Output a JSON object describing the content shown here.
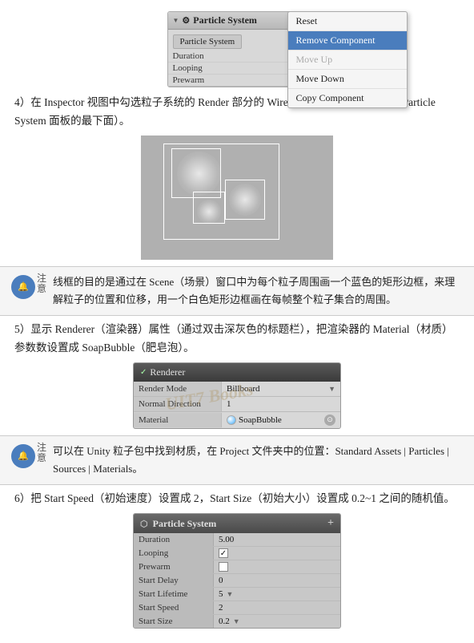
{
  "top_panel": {
    "title": "Particle System",
    "tab": "Particle System",
    "rows": [
      "Duration",
      "Looping",
      "Prewarm"
    ],
    "menu_items": [
      {
        "label": "Reset",
        "state": "normal"
      },
      {
        "label": "Remove Component",
        "state": "selected"
      },
      {
        "label": "Move Up",
        "state": "disabled"
      },
      {
        "label": "Move Down",
        "state": "normal"
      },
      {
        "label": "Copy Component",
        "state": "normal"
      }
    ]
  },
  "section4_text": "4）在 Inspector 视图中勾选粒子系统的 Render 部分的 Wireframe（线框）选项（在 Particle System 面板的最下面）。",
  "note1_label": "注意",
  "note1_text": "线框的目的是通过在 Scene（场景）窗口中为每个粒子周围画一个蓝色的矩形边框，来理解粒子的位置和位移，用一个白色矩形边框画在每帧整个粒子集合的周围。",
  "section5_text": "5）显示 Renderer（渲染器）属性（通过双击深灰色的标题栏），把渲染器的 Material（材质）参数数设置成 SoapBubble（肥皂泡）。",
  "renderer_panel": {
    "title": "Renderer",
    "rows": [
      {
        "label": "Render Mode",
        "value": "Billboard",
        "has_arrow": true
      },
      {
        "label": "Normal Direction",
        "value": "1",
        "has_arrow": false
      },
      {
        "label": "Material",
        "value": "SoapBubble",
        "has_circle": true
      }
    ]
  },
  "note2_label": "注意",
  "note2_text": "可以在 Unity 粒子包中找到材质，在 Project 文件夹中的位置：Standard Assets | Particles | Sources | Materials。",
  "section6_text": "6）把 Start Speed（初始速度）设置成 2，Start Size（初始大小）设置成 0.2~1 之间的随机值。",
  "ps_bottom_panel": {
    "title": "Particle System",
    "rows": [
      {
        "label": "Duration",
        "value": "5.00",
        "type": "text"
      },
      {
        "label": "Looping",
        "value": "✓",
        "type": "check"
      },
      {
        "label": "Prewarm",
        "value": "",
        "type": "empty"
      },
      {
        "label": "Start Delay",
        "value": "0",
        "type": "text"
      },
      {
        "label": "Start Lifetime",
        "value": "5",
        "type": "text_arrow"
      },
      {
        "label": "Start Speed",
        "value": "2",
        "type": "text"
      },
      {
        "label": "Start Size",
        "value": "0.2",
        "type": "text_arrow"
      }
    ]
  },
  "watermark": "UIT7 Books"
}
